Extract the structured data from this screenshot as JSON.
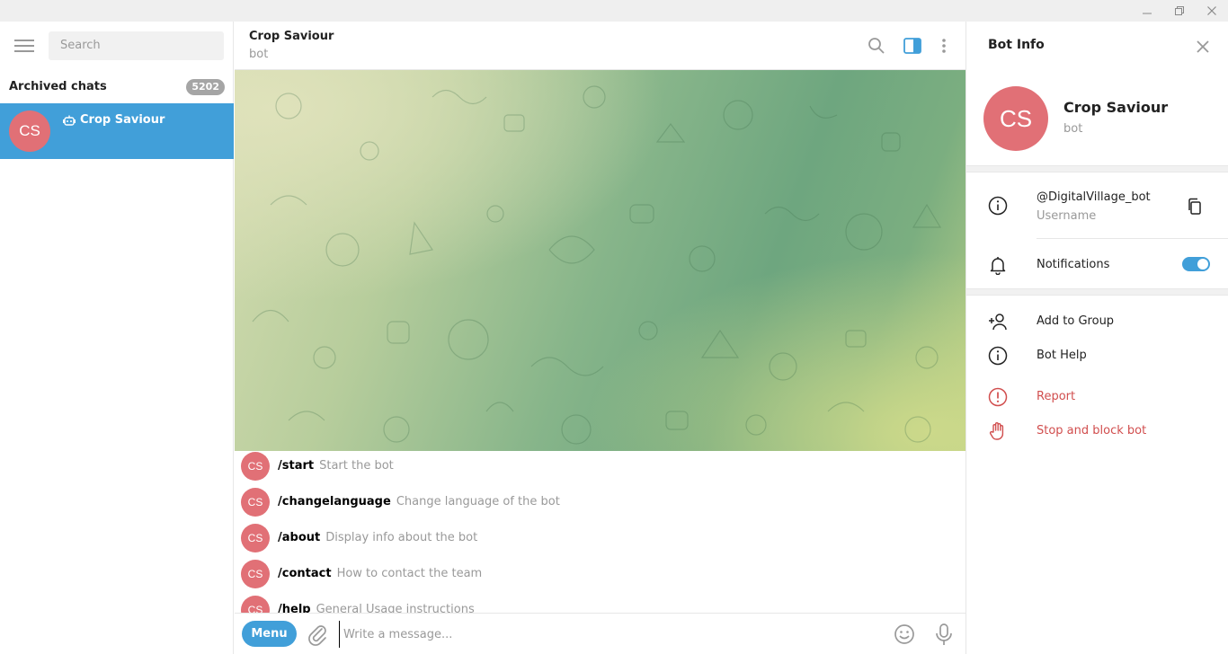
{
  "sidebar": {
    "search_placeholder": "Search",
    "archived_label": "Archived chats",
    "archived_count": "5202",
    "chats": [
      {
        "initials": "CS",
        "title": "Crop Saviour",
        "icon": "bot-icon"
      }
    ]
  },
  "chat": {
    "title": "Crop Saviour",
    "status": "bot",
    "commands": [
      {
        "initials": "CS",
        "name": "/start",
        "desc": "Start the bot"
      },
      {
        "initials": "CS",
        "name": "/changelanguage",
        "desc": "Change language of the bot"
      },
      {
        "initials": "CS",
        "name": "/about",
        "desc": "Display info about the bot"
      },
      {
        "initials": "CS",
        "name": "/contact",
        "desc": "How to contact the team"
      },
      {
        "initials": "CS",
        "name": "/help",
        "desc": "General Usage instructions"
      }
    ],
    "menu_label": "Menu",
    "input_placeholder": "Write a message..."
  },
  "info_panel": {
    "title": "Bot Info",
    "initials": "CS",
    "name": "Crop Saviour",
    "subtitle": "bot",
    "username": "@DigitalVillage_bot",
    "username_label": "Username",
    "notifications_label": "Notifications",
    "notifications_on": true,
    "actions": [
      {
        "label": "Add to Group",
        "icon": "add-user-icon"
      },
      {
        "label": "Bot Help",
        "icon": "info-icon"
      },
      {
        "label": "Report",
        "icon": "report-icon"
      },
      {
        "label": "Stop and block bot",
        "icon": "hand-stop-icon"
      }
    ]
  },
  "colors": {
    "accent": "#419fd9",
    "avatar": "#e17076",
    "danger": "#d14e4e"
  }
}
